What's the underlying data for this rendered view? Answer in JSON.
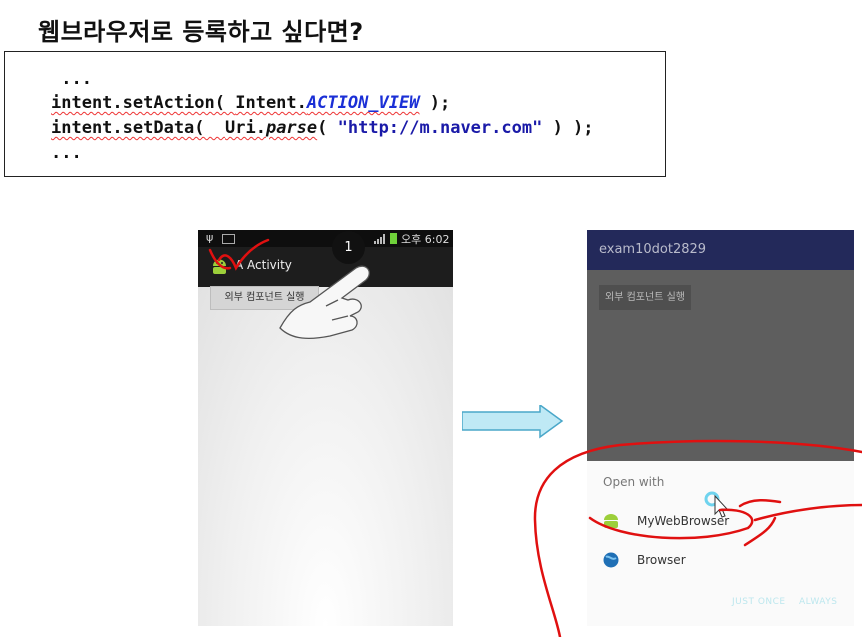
{
  "slide": {
    "title": "웹브라우저로 등록하고 싶다면?",
    "code": {
      "line1": " ...",
      "line2_a": "intent.setAction( ",
      "line2_b": "Intent.",
      "line2_c": "ACTION_VIEW",
      "line2_d": " );",
      "line3_a": "intent.setData(  ",
      "line3_b": "Uri.",
      "line3_c": "parse",
      "line3_d": "( ",
      "line3_e": "\"http://m.naver.com\"",
      "line3_f": " ) );",
      "line4": "..."
    }
  },
  "left_phone": {
    "status_time": "오후 6:02",
    "action_bar_title": "A Activity",
    "button_label": "외부 컴포넌트 실행",
    "tap_badge": "1"
  },
  "right_phone": {
    "app_title": "exam10dot2829",
    "button_label": "외부 컴포넌트 실행",
    "chooser": {
      "heading": "Open with",
      "apps": [
        "MyWebBrowser",
        "Browser"
      ],
      "just_once": "JUST ONCE",
      "always": "ALWAYS"
    }
  },
  "colors": {
    "code_blue": "#1a2fd6",
    "dark_actionbar": "#23295a",
    "arrow_fill": "#bfe9f5",
    "annotation_red": "#e01010"
  }
}
